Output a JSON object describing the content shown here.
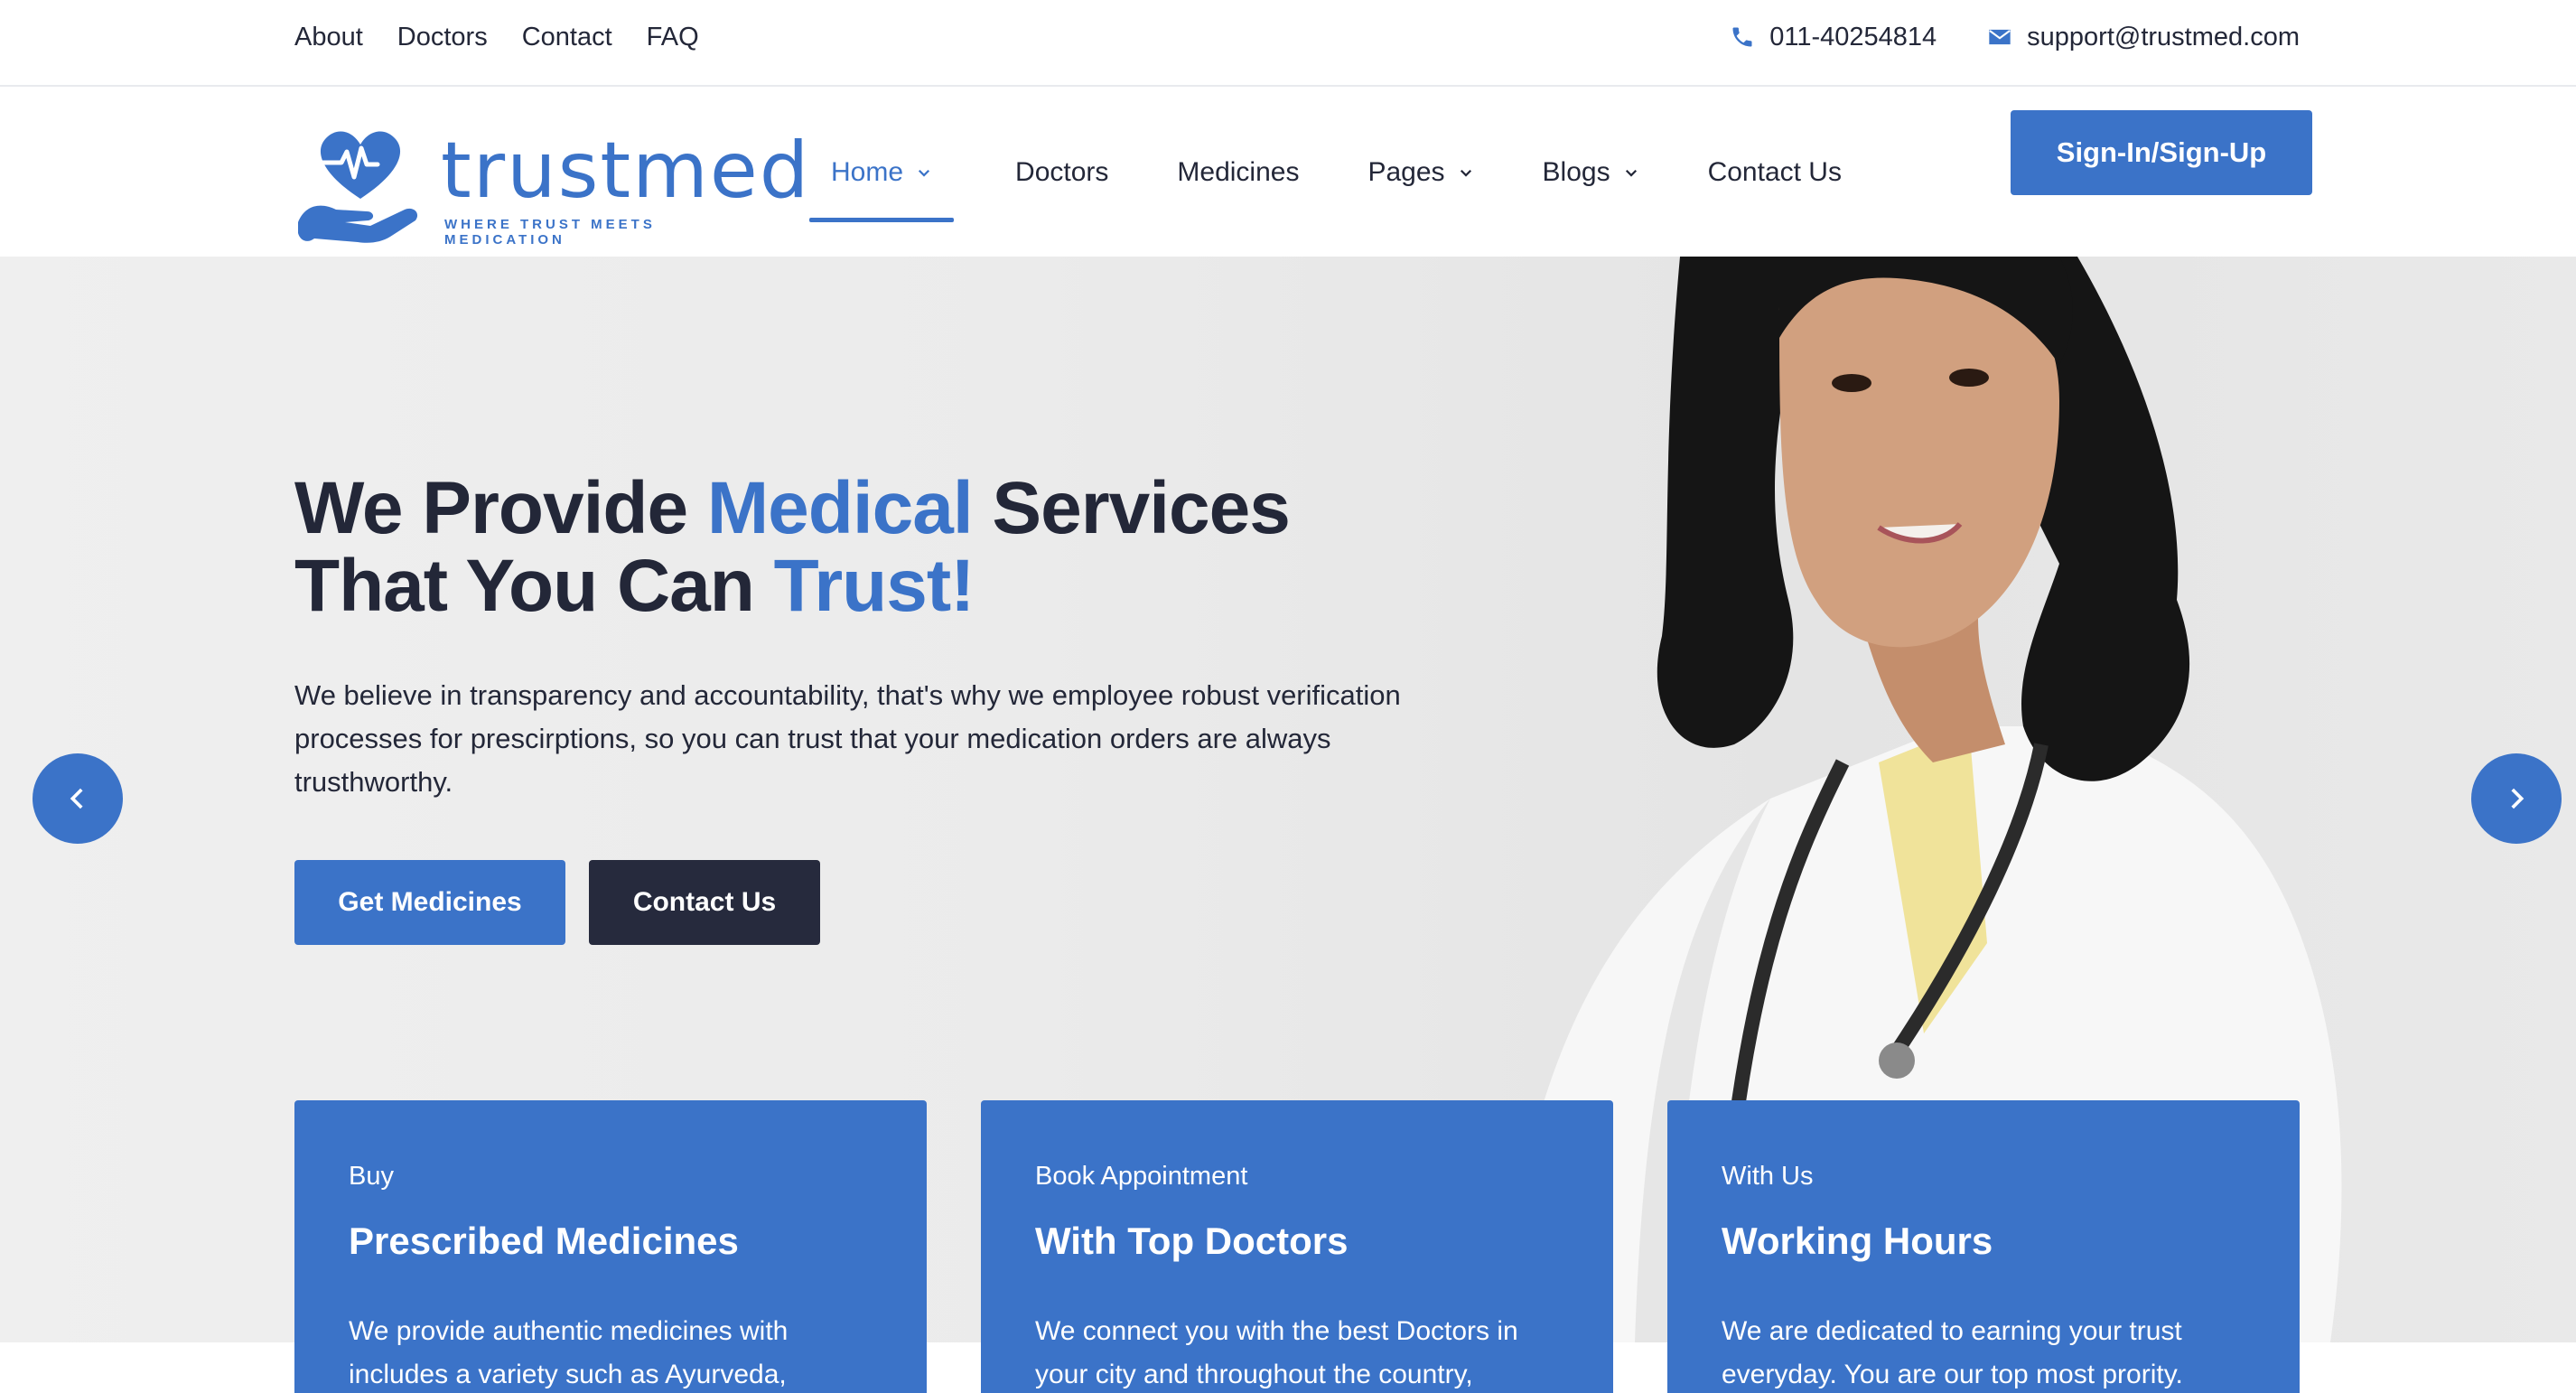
{
  "topbar": {
    "links": [
      "About",
      "Doctors",
      "Contact",
      "FAQ"
    ],
    "phone": "011-40254814",
    "email": "support@trustmed.com"
  },
  "brand": {
    "name": "trustmed",
    "tagline": "WHERE TRUST MEETS MEDICATION",
    "color": "#3b73c8"
  },
  "nav": {
    "items": [
      {
        "label": "Home",
        "has_dropdown": true,
        "active": true
      },
      {
        "label": "Doctors",
        "has_dropdown": false,
        "active": false
      },
      {
        "label": "Medicines",
        "has_dropdown": false,
        "active": false
      },
      {
        "label": "Pages",
        "has_dropdown": true,
        "active": false
      },
      {
        "label": "Blogs",
        "has_dropdown": true,
        "active": false
      },
      {
        "label": "Contact Us",
        "has_dropdown": false,
        "active": false
      }
    ],
    "signin_label": "Sign-In/Sign-Up"
  },
  "hero": {
    "headline_1a": "We Provide ",
    "headline_1b": "Medical",
    "headline_1c": " Services",
    "headline_2a": "That You Can ",
    "headline_2b": "Trust!",
    "description": "We believe in transparency and accountability, that's why we employee robust verification processes for prescirptions, so you can trust that your medication orders are always trusthworthy.",
    "primary_button": "Get Medicines",
    "secondary_button": "Contact Us"
  },
  "cards": [
    {
      "eyebrow": "Buy",
      "title": "Prescribed Medicines",
      "body": "We provide authentic medicines with includes a variety such as Ayurveda,"
    },
    {
      "eyebrow": "Book Appointment",
      "title": "With Top Doctors",
      "body": "We connect you with the best Doctors in your city and throughout the country,"
    },
    {
      "eyebrow": "With Us",
      "title": "Working Hours",
      "body": "We are dedicated to earning your trust everyday. You are our top most prority."
    }
  ],
  "icons": {
    "phone": "phone-icon",
    "email": "envelope-icon",
    "prev": "chevron-left-icon",
    "next": "chevron-right-icon",
    "dropdown": "chevron-down-icon"
  }
}
